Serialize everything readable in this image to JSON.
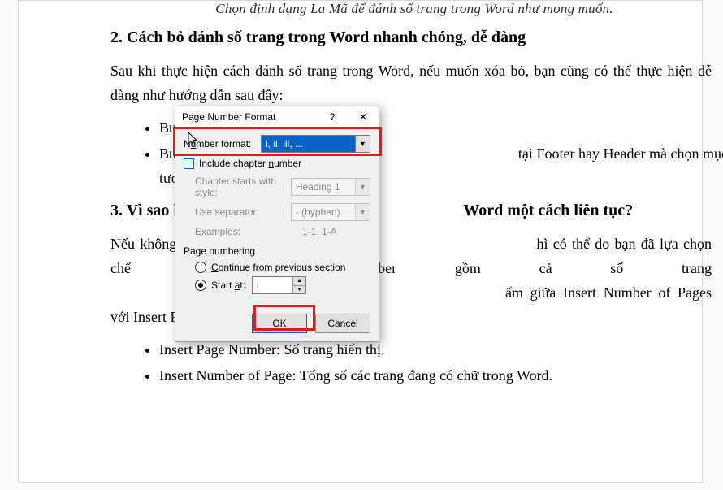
{
  "doc": {
    "caption": "Chọn định dạng La Mã để đánh số trang trong Word như mong muốn.",
    "h2_1": "2. Cách bỏ đánh số trang trong Word nhanh chóng, dễ dàng",
    "p1": "Sau khi thực hiện cách đánh số trang trong Word, nếu muốn xóa bỏ, bạn cũng có thể thực hiện dễ dàng như hướng dẫn sau đây:",
    "bullets1": [
      "Bước",
      "Bước                                                                                         tại Footer hay Header mà chọn mục tương ứng, sau đó"
    ],
    "h2_2_pre": "3. Vì sao kh",
    "h2_2_post": " Word một cách liên tục?",
    "p2_pre": "Nếu không th",
    "p2_mid": "hì có thể do bạn đã lựa chọn chế độ Page Number gồm cả số trang",
    "p2_mid2": "ẩm giữa Insert Number of Pages với Insert Page Number. Tron",
    "bullets2": [
      "Insert Page Number: Số trang hiển thị.",
      "Insert Number of Page: Tổng số các trang đang có chữ trong Word."
    ]
  },
  "dialog": {
    "title": "Page Number Format",
    "help": "?",
    "close": "✕",
    "number_format_label": "Number format:",
    "number_format_value": "i, ii, iii, ...",
    "include_chapter": "Include chapter number",
    "chapter_starts_label": "Chapter starts with style:",
    "chapter_starts_value": "Heading 1",
    "use_separator_label": "Use separator:",
    "use_separator_value": "-  (hyphen)",
    "examples_label": "Examples:",
    "examples_value": "1-1, 1-A",
    "page_numbering": "Page numbering",
    "continue_label": "Continue from previous section",
    "start_at_label": "Start at:",
    "start_at_value": "i",
    "ok": "OK",
    "cancel": "Cancel"
  }
}
